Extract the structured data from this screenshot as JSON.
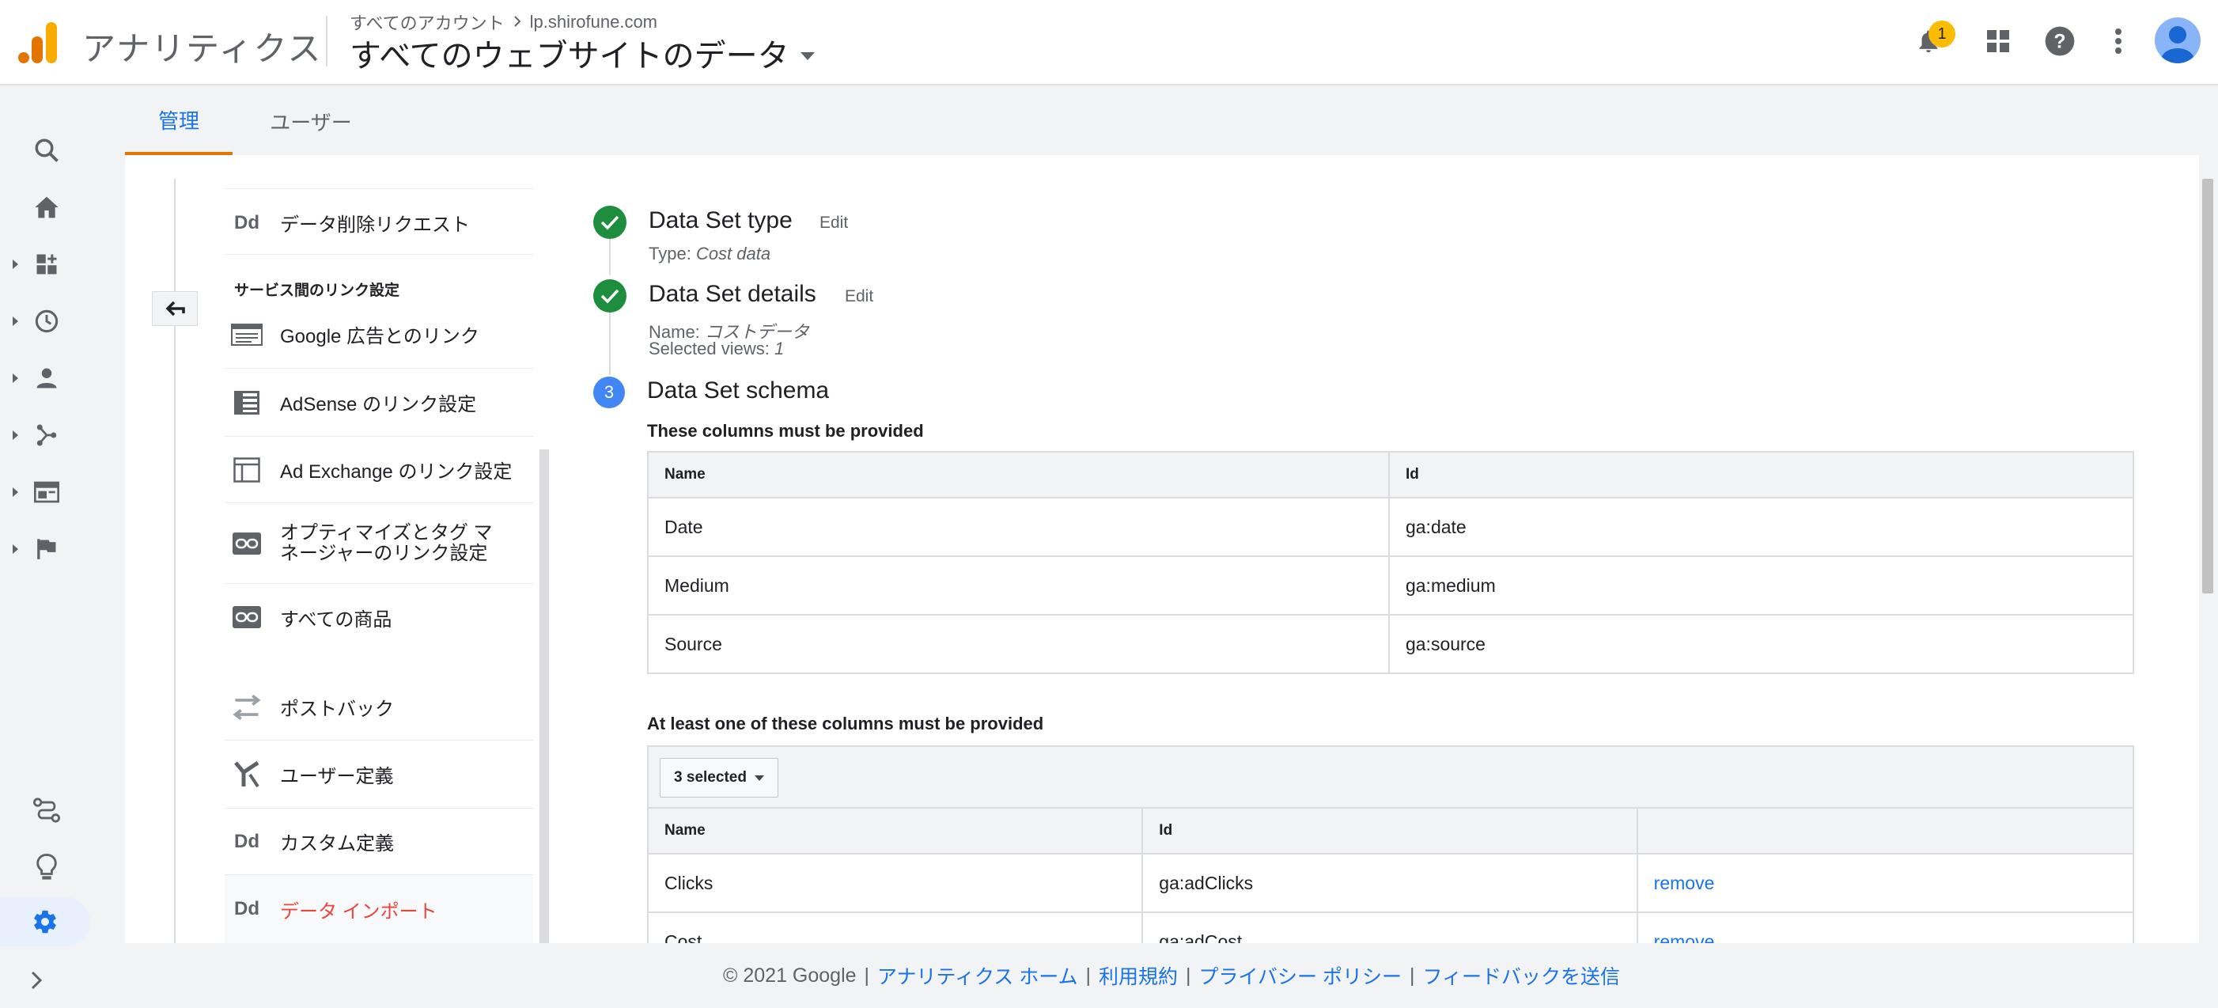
{
  "header": {
    "product": "アナリティクス",
    "breadcrumb_account": "すべてのアカウント",
    "breadcrumb_property": "lp.shirofune.com",
    "view_name": "すべてのウェブサイトのデータ",
    "notification_count": "1"
  },
  "tabs": [
    "管理",
    "ユーザー"
  ],
  "nav": {
    "items_top": [
      {
        "label": "データ削除リクエスト",
        "icon": "dd-icon"
      }
    ],
    "section_label": "サービス間のリンク設定",
    "items_links": [
      {
        "label": "Google 広告とのリンク",
        "icon": "ads-icon"
      },
      {
        "label": "AdSense のリンク設定",
        "icon": "adsense-icon"
      },
      {
        "label": "Ad Exchange のリンク設定",
        "icon": "adexchange-icon"
      },
      {
        "label": "オプティマイズとタグ マネージャーのリンク設定",
        "icon": "link-icon"
      },
      {
        "label": "すべての商品",
        "icon": "link-icon"
      }
    ],
    "items_bottom": [
      {
        "label": "ポストバック",
        "icon": "postback-icon"
      },
      {
        "label": "ユーザー定義",
        "icon": "fork-icon"
      },
      {
        "label": "カスタム定義",
        "icon": "dd-icon"
      },
      {
        "label": "データ インポート",
        "icon": "dd-icon",
        "active": true
      }
    ]
  },
  "steps": {
    "step1": {
      "title": "Data Set type",
      "edit": "Edit",
      "detail_label": "Type:",
      "detail_value": "Cost data"
    },
    "step2": {
      "title": "Data Set details",
      "edit": "Edit",
      "name_label": "Name:",
      "name_value": "コストデータ",
      "views_label": "Selected views:",
      "views_value": "1"
    },
    "step3": {
      "number": "3",
      "title": "Data Set schema"
    }
  },
  "required": {
    "heading": "These columns must be provided",
    "columns": [
      "Name",
      "Id"
    ],
    "rows": [
      [
        "Date",
        "ga:date"
      ],
      [
        "Medium",
        "ga:medium"
      ],
      [
        "Source",
        "ga:source"
      ]
    ]
  },
  "optional": {
    "heading": "At least one of these columns must be provided",
    "selected_label": "3 selected",
    "columns": [
      "Name",
      "Id",
      ""
    ],
    "rows": [
      [
        "Clicks",
        "ga:adClicks",
        "remove"
      ],
      [
        "Cost",
        "ga:adCost",
        "remove"
      ]
    ]
  },
  "footer": {
    "copyright": "© 2021 Google",
    "links": [
      "アナリティクス ホーム",
      "利用規約",
      "プライバシー ポリシー",
      "フィードバックを送信"
    ]
  },
  "colors": {
    "accent_blue": "#1a73e8",
    "tab_underline": "#e37400",
    "success_green": "#1e8e3e",
    "active_nav_red": "#e8453c"
  }
}
